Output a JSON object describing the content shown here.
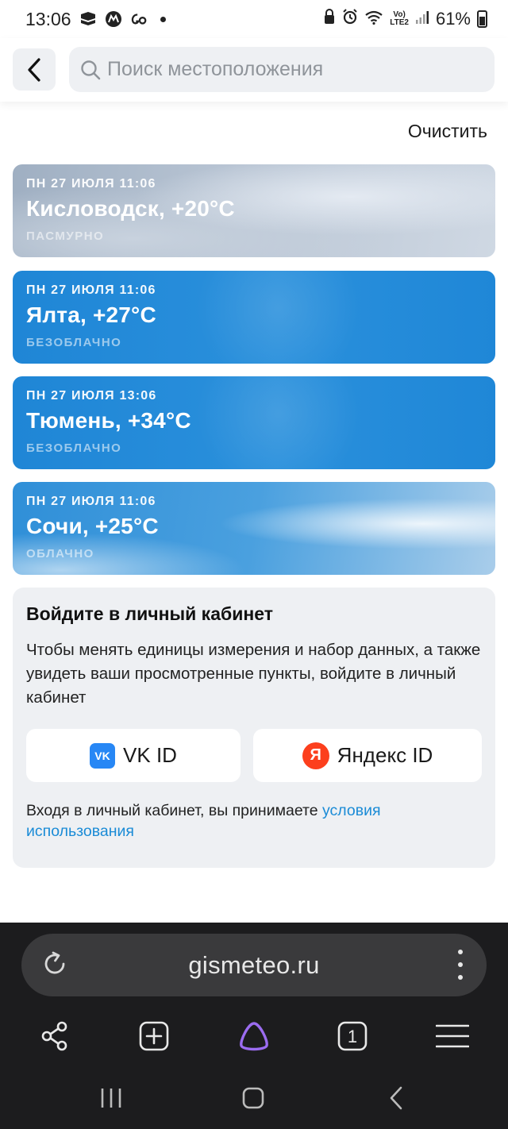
{
  "status_bar": {
    "time": "13:06",
    "battery": "61%",
    "network": "LTE2"
  },
  "header": {
    "search_placeholder": "Поиск местоположения"
  },
  "clear_label": "Очистить",
  "cards": [
    {
      "date": "ПН 27 июля 11:06",
      "city": "Кисловодск, +20°C",
      "condition": "пасмурно"
    },
    {
      "date": "ПН 27 июля 11:06",
      "city": "Ялта, +27°C",
      "condition": "безоблачно"
    },
    {
      "date": "ПН 27 июля 13:06",
      "city": "Тюмень, +34°C",
      "condition": "безоблачно"
    },
    {
      "date": "ПН 27 июля 11:06",
      "city": "Сочи, +25°C",
      "condition": "облачно"
    }
  ],
  "login": {
    "title": "Войдите в личный кабинет",
    "description": "Чтобы менять единицы измерения и набор данных, а также увидеть ваши просмотренные пункты, войдите в личный кабинет",
    "vk_label": "VK ID",
    "vk_logo": "VK",
    "yandex_label": "Яндекс ID",
    "yandex_logo": "Я",
    "terms_text": "Входя в личный кабинет, вы принимаете ",
    "terms_link": "условия использования"
  },
  "browser": {
    "url": "gismeteo.ru",
    "tabs_count": "1"
  },
  "colors": {
    "accent_link": "#1a8bd6",
    "card_clear": "#1f86d6",
    "browser_bg": "#1c1c1e",
    "alice_purple": "#9b6cf0"
  }
}
